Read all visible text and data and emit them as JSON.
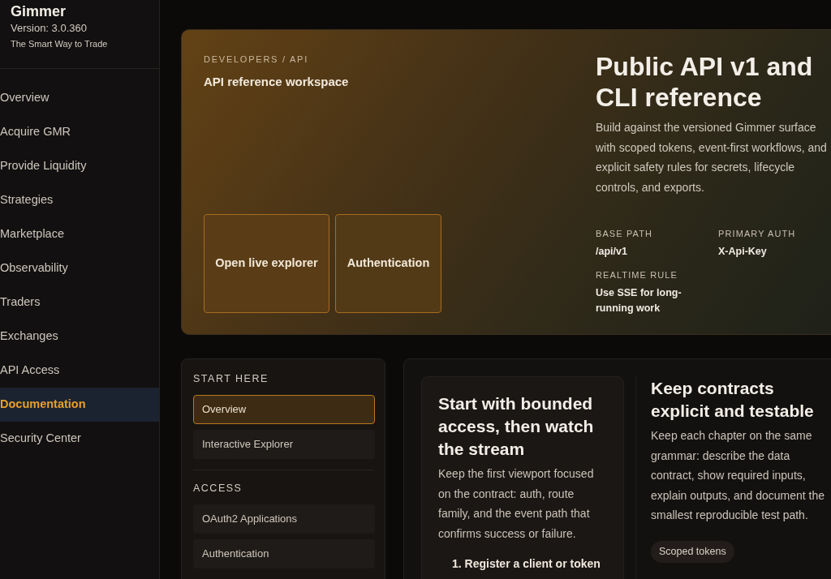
{
  "sidebar": {
    "brand": "Gimmer",
    "version": "Version: 3.0.360",
    "tagline": "The Smart Way to Trade",
    "items": [
      {
        "label": "Overview",
        "selected": false
      },
      {
        "label": "Acquire GMR",
        "selected": false
      },
      {
        "label": "Provide Liquidity",
        "selected": false
      },
      {
        "label": "Strategies",
        "selected": false
      },
      {
        "label": "Marketplace",
        "selected": false
      },
      {
        "label": "Observability",
        "selected": false
      },
      {
        "label": "Traders",
        "selected": false
      },
      {
        "label": "Exchanges",
        "selected": false
      },
      {
        "label": "API Access",
        "selected": false
      },
      {
        "label": "Documentation",
        "selected": true
      },
      {
        "label": "Security Center",
        "selected": false
      }
    ]
  },
  "hero": {
    "breadcrumb": "DEVELOPERS / API",
    "subtitle": "API reference workspace",
    "actions": [
      "Open live explorer",
      "Authentication"
    ],
    "title": "Public API v1 and CLI reference",
    "description": "Build against the versioned Gimmer surface with scoped tokens, event-first workflows, and explicit safety rules for secrets, lifecycle controls, and exports.",
    "meta": [
      {
        "label": "BASE PATH",
        "value": "/api/v1"
      },
      {
        "label": "PRIMARY AUTH",
        "value": "X-Api-Key"
      },
      {
        "label": "REALTIME RULE",
        "value": "Use SSE for long-running work"
      }
    ]
  },
  "doc_nav": {
    "sections": [
      {
        "heading": "START HERE",
        "items": [
          {
            "label": "Overview",
            "selected": true
          },
          {
            "label": "Interactive Explorer",
            "selected": false
          }
        ]
      },
      {
        "heading": "ACCESS",
        "items": [
          {
            "label": "OAuth2 Applications",
            "selected": false
          },
          {
            "label": "Authentication",
            "selected": false
          }
        ]
      }
    ]
  },
  "content": {
    "intro": {
      "title": "Start with bounded access, then watch the stream",
      "body": "Keep the first viewport focused on the contract: auth, route family, and the event path that confirms success or failure.",
      "steps": [
        {
          "number": "1.",
          "text": "Register a client or token"
        }
      ]
    },
    "principles": {
      "title": "Keep contracts explicit and testable",
      "body": "Keep each chapter on the same grammar: describe the data contract, show required inputs, explain outputs, and document the smallest reproducible test path.",
      "tags": [
        "Scoped tokens"
      ]
    }
  }
}
